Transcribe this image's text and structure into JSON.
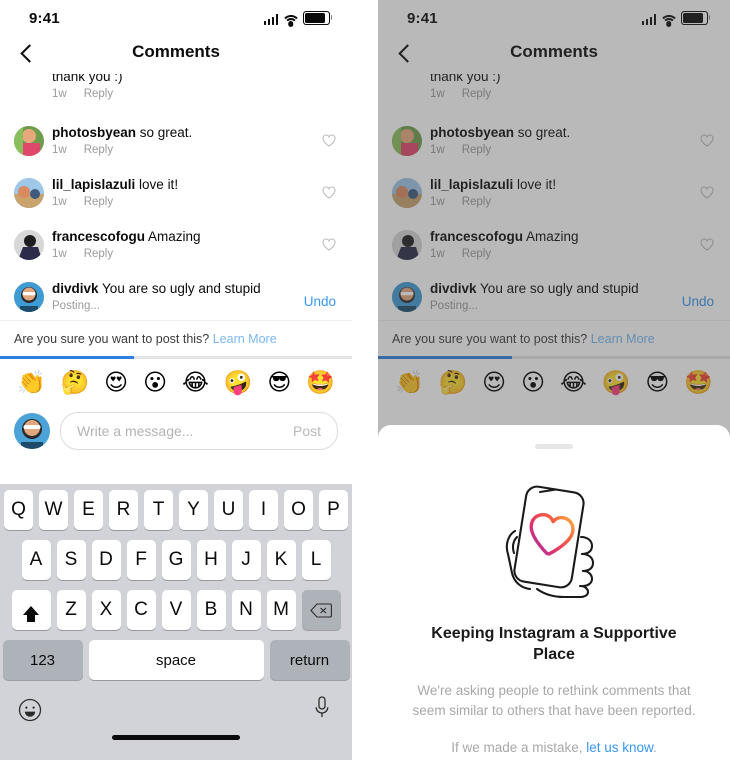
{
  "status_bar": {
    "time": "9:41",
    "signal_icon": "cellular-signal-icon",
    "wifi_icon": "wifi-icon",
    "battery_icon": "battery-icon"
  },
  "nav": {
    "back_icon": "chevron-left-icon",
    "title": "Comments"
  },
  "comments": {
    "partial_top": {
      "text": "thank you :)",
      "time": "1w",
      "reply": "Reply"
    },
    "items": [
      {
        "username": "photosbyean",
        "text": "so great.",
        "time": "1w",
        "reply": "Reply",
        "like_icon": "heart-outline-icon"
      },
      {
        "username": "lil_lapislazuli",
        "text": "love it!",
        "time": "1w",
        "reply": "Reply",
        "like_icon": "heart-outline-icon"
      },
      {
        "username": "francescofogu",
        "text": "Amazing",
        "time": "1w",
        "reply": "Reply",
        "like_icon": "heart-outline-icon"
      }
    ],
    "pending": {
      "username": "divdivk",
      "text": "You are so ugly and stupid",
      "status": "Posting...",
      "undo_label": "Undo",
      "undo_color": "#3897f0"
    }
  },
  "warning": {
    "message": "Are you sure you want to post this?",
    "learn_more": "Learn More",
    "learn_more_color": "#79b8f3",
    "progress_percent": 38,
    "progress_color": "#2d7fe0"
  },
  "emoji_bar": {
    "emojis": [
      "👏",
      "🤔",
      "😍",
      "😮",
      "😂",
      "🤪",
      "😎",
      "🤩"
    ]
  },
  "message_bar": {
    "avatar_icon": "user-avatar",
    "placeholder": "Write a message...",
    "post_label": "Post"
  },
  "keyboard": {
    "row1": [
      "Q",
      "W",
      "E",
      "R",
      "T",
      "Y",
      "U",
      "I",
      "O",
      "P"
    ],
    "row2": [
      "A",
      "S",
      "D",
      "F",
      "G",
      "H",
      "J",
      "K",
      "L"
    ],
    "row3": [
      "Z",
      "X",
      "C",
      "V",
      "B",
      "N",
      "M"
    ],
    "shift_icon": "shift-arrow-icon",
    "delete_icon": "backspace-icon",
    "numbers_label": "123",
    "space_label": "space",
    "return_label": "return",
    "emoji_icon": "smiley-face-icon",
    "mic_icon": "microphone-icon",
    "home_indicator": "home-indicator"
  },
  "sheet": {
    "handle": "drag-handle",
    "illustration": "hand-holding-phone-with-heart-illustration",
    "title": "Keeping Instagram a Supportive Place",
    "body": "We're asking people to rethink comments that seem similar to others that have been reported.",
    "footer_prefix": "If we made a mistake, ",
    "footer_link": "let us know",
    "footer_suffix": ".",
    "link_color": "#3897f0"
  }
}
